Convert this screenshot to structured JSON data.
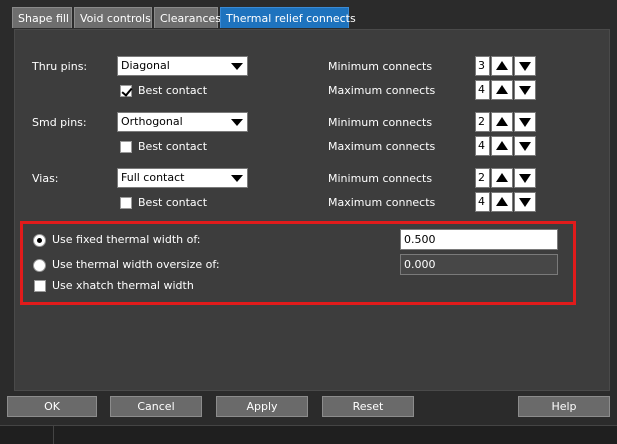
{
  "tabs": [
    {
      "label": "Shape fill",
      "active": false
    },
    {
      "label": "Void controls",
      "active": false
    },
    {
      "label": "Clearances",
      "active": false
    },
    {
      "label": "Thermal relief connects",
      "active": true
    }
  ],
  "rows": [
    {
      "label": "Thru pins:",
      "dropdown": "Diagonal",
      "best_contact_label": "Best contact",
      "best_contact_checked": true,
      "min_label": "Minimum connects",
      "min_value": "3",
      "max_label": "Maximum connects",
      "max_value": "4"
    },
    {
      "label": "Smd pins:",
      "dropdown": "Orthogonal",
      "best_contact_label": "Best contact",
      "best_contact_checked": false,
      "min_label": "Minimum connects",
      "min_value": "2",
      "max_label": "Maximum connects",
      "max_value": "4"
    },
    {
      "label": "Vias:",
      "dropdown": "Full contact",
      "best_contact_label": "Best contact",
      "best_contact_checked": false,
      "min_label": "Minimum connects",
      "min_value": "2",
      "max_label": "Maximum connects",
      "max_value": "4"
    }
  ],
  "width": {
    "fixed_label": "Use fixed thermal width of:",
    "fixed_value": "0.500",
    "fixed_selected": true,
    "oversize_label": "Use thermal width oversize of:",
    "oversize_value": "0.000",
    "oversize_selected": false,
    "xhatch_label": "Use xhatch thermal width",
    "xhatch_checked": false
  },
  "buttons": {
    "ok": "OK",
    "cancel": "Cancel",
    "apply": "Apply",
    "reset": "Reset",
    "help": "Help"
  },
  "colors": {
    "active_tab": "#1e73be",
    "highlight_box": "#e11b1b"
  }
}
